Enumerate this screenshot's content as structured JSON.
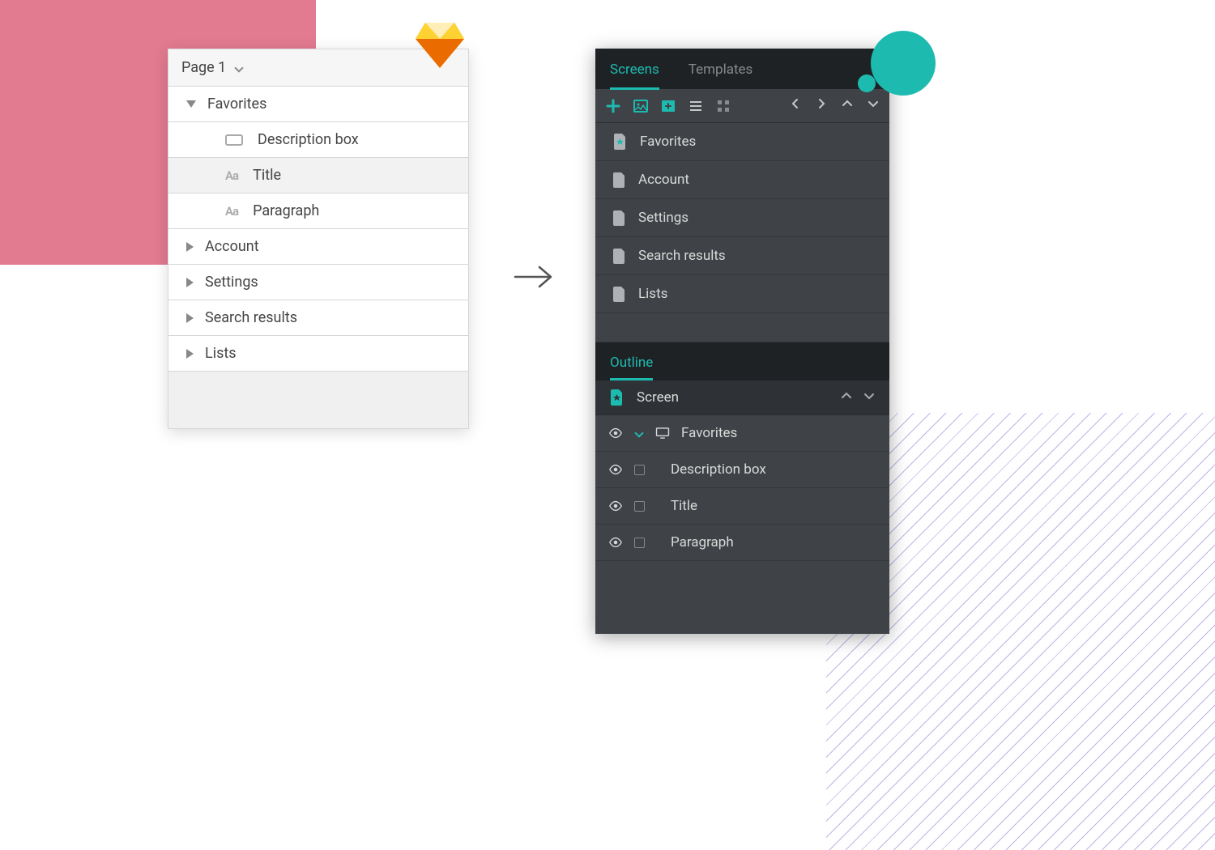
{
  "colors": {
    "pink": "#e27a90",
    "teal": "#1dbab0"
  },
  "left_panel": {
    "page_label": "Page 1",
    "items": [
      {
        "label": "Favorites",
        "expanded": true
      },
      {
        "label": "Account",
        "expanded": false
      },
      {
        "label": "Settings",
        "expanded": false
      },
      {
        "label": "Search results",
        "expanded": false
      },
      {
        "label": "Lists",
        "expanded": false
      }
    ],
    "favorites_children": [
      {
        "icon": "rect",
        "label": "Description box"
      },
      {
        "icon": "aa",
        "label": "Title",
        "highlight": true
      },
      {
        "icon": "aa",
        "label": "Paragraph"
      }
    ]
  },
  "right_panel": {
    "tabs": [
      {
        "label": "Screens",
        "active": true
      },
      {
        "label": "Templates",
        "active": false
      }
    ],
    "screens": [
      {
        "label": "Favorites",
        "starred": true
      },
      {
        "label": "Account"
      },
      {
        "label": "Settings"
      },
      {
        "label": "Search results"
      },
      {
        "label": "Lists"
      }
    ],
    "sub_tab": "Outline",
    "screen_label": "Screen",
    "outline_root": "Favorites",
    "outline_items": [
      {
        "label": "Description box"
      },
      {
        "label": "Title"
      },
      {
        "label": "Paragraph"
      }
    ]
  }
}
